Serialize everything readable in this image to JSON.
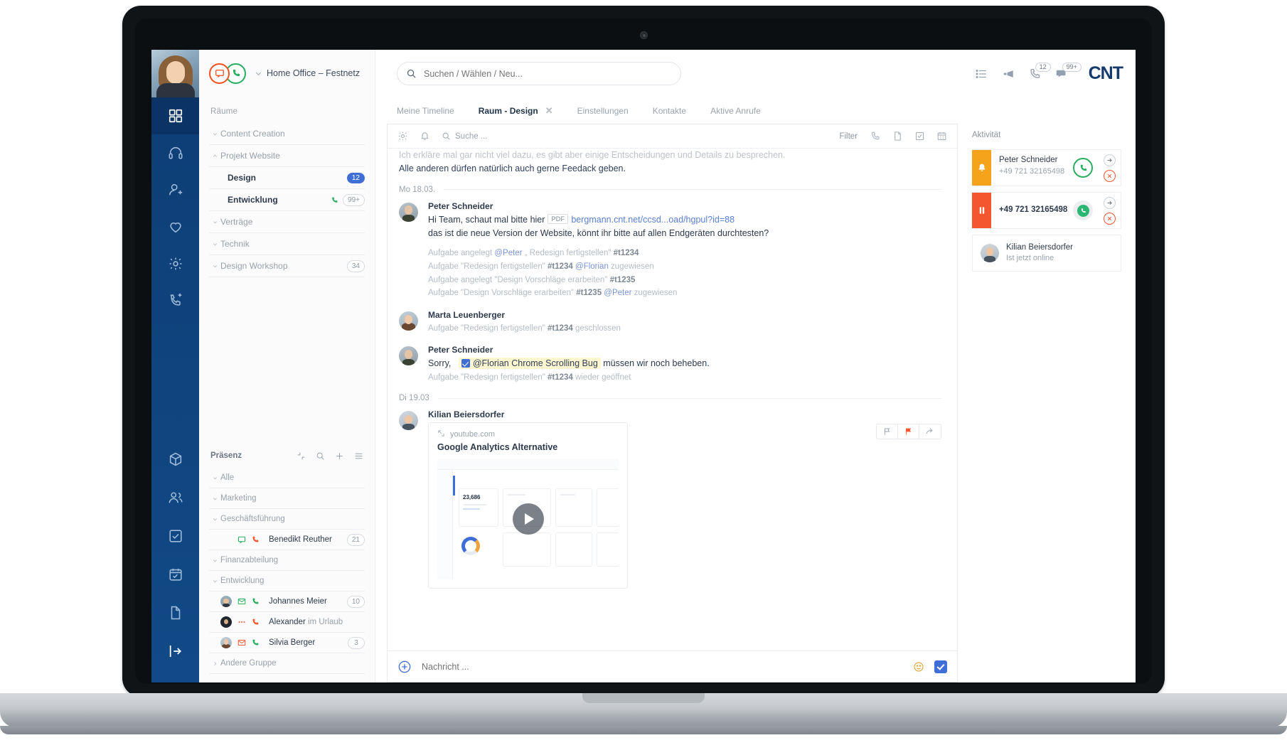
{
  "brand": {
    "logo": "CNT"
  },
  "status": {
    "chat_icon": "chat-bubble-icon",
    "phone_icon": "phone-handset-icon",
    "label": "Home Office – Festnetz"
  },
  "search": {
    "placeholder": "Suchen / Wählen / Neu...",
    "value": ""
  },
  "topbar_icons": [
    {
      "name": "list-icon",
      "badge": ""
    },
    {
      "name": "megaphone-icon",
      "badge": ""
    },
    {
      "name": "phone-icon",
      "badge": "12"
    },
    {
      "name": "chat-icon",
      "badge": "99+"
    }
  ],
  "tabs": [
    {
      "label": "Meine Timeline",
      "active": false,
      "closable": false
    },
    {
      "label": "Raum - Design",
      "active": true,
      "closable": true
    },
    {
      "label": "Einstellungen",
      "active": false,
      "closable": false
    },
    {
      "label": "Kontakte",
      "active": false,
      "closable": false
    },
    {
      "label": "Aktive Anrufe",
      "active": false,
      "closable": false
    }
  ],
  "sidebar": {
    "rooms_title": "Räume",
    "rooms": [
      {
        "label": "Content Creation",
        "type": "group",
        "caret": "down",
        "badge": ""
      },
      {
        "label": "Projekt Website",
        "type": "group",
        "caret": "up",
        "badge": ""
      },
      {
        "label": "Design",
        "type": "leaf",
        "badge": "12",
        "badge_style": "blue"
      },
      {
        "label": "Entwicklung",
        "type": "leaf",
        "badge": "99+",
        "badge_style": "grey",
        "phone": true
      },
      {
        "label": "Verträge",
        "type": "group",
        "caret": "down",
        "badge": ""
      },
      {
        "label": "Technik",
        "type": "group",
        "caret": "down",
        "badge": ""
      },
      {
        "label": "Design Workshop",
        "type": "group",
        "caret": "down",
        "badge": "34",
        "badge_style": "grey"
      }
    ],
    "presence_title": "Präsenz",
    "presence_actions": [
      "collapse-icon",
      "search-icon",
      "plus-icon",
      "menu-icon"
    ],
    "presence": [
      {
        "label": "Alle",
        "type": "group",
        "caret": "down"
      },
      {
        "label": "Marketing",
        "type": "group",
        "caret": "down"
      },
      {
        "label": "Geschäftsführung",
        "type": "group",
        "caret": "down"
      },
      {
        "label": "Benedikt Reuther",
        "type": "member",
        "avatar": false,
        "icon1": "chat-green-icon",
        "icon2": "phone-red-icon",
        "badge": "21",
        "sub": ""
      },
      {
        "label": "Finanzabteilung",
        "type": "group",
        "caret": "down"
      },
      {
        "label": "Entwicklung",
        "type": "group",
        "caret": "down"
      },
      {
        "label": "Johannes Meier",
        "type": "member",
        "avatar": true,
        "avatar_style": "av-p1",
        "icon1": "mail-green-icon",
        "icon2": "phone-green-icon",
        "badge": "10",
        "sub": ""
      },
      {
        "label": "Alexander",
        "type": "member",
        "avatar": true,
        "avatar_style": "av-dark",
        "icon1": "dots-red-icon",
        "icon2": "phone-red-icon",
        "badge": "",
        "sub": "im Urlaub"
      },
      {
        "label": "Silvia Berger",
        "type": "member",
        "avatar": true,
        "avatar_style": "av-p2",
        "icon1": "mail-red-icon",
        "icon2": "phone-green-icon",
        "badge": "3",
        "sub": ""
      },
      {
        "label": "Andere Gruppe",
        "type": "group",
        "caret": "right"
      }
    ]
  },
  "chat": {
    "toolbar": {
      "gear_icon": "gear-icon",
      "bell_icon": "bell-icon",
      "search_placeholder": "Suche ...",
      "filter_label": "Filter",
      "right_icons": [
        "phone-icon",
        "document-icon",
        "task-icon",
        "calendar-icon"
      ]
    },
    "scrolled_lines": [
      "Ich erkläre mal gar nicht viel dazu, es gibt aber einige Entscheidungen und Details zu besprechen.",
      "Alle anderen dürfen natürlich auch gerne Feedack geben."
    ],
    "day1": "Mo 18.03.",
    "day2": "Di 19.03",
    "messages": [
      {
        "author": "Peter Schneider",
        "avatar_style": "av-p3",
        "text_prefix": "Hi Team, schaut mal bitte hier",
        "pdf_chip": "PDF",
        "link": "bergmann.cnt.net/ccsd...oad/hgpul?id=88",
        "text_line2": "das ist die neue Version der Website, könnt ihr bitte auf allen Endgeräten durchtesten?",
        "system_lines": [
          {
            "parts": [
              {
                "t": "Aufgabe angelegt ",
                "k": "plain"
              },
              {
                "t": "@Peter",
                "k": "mention"
              },
              {
                "t": " „ Redesign fertigstellen\" ",
                "k": "plain"
              },
              {
                "t": "#t1234",
                "k": "tid"
              }
            ]
          },
          {
            "parts": [
              {
                "t": "Aufgabe \"Redesign fertigstellen\" ",
                "k": "plain"
              },
              {
                "t": "#t1234",
                "k": "tid"
              },
              {
                "t": " ",
                "k": "plain"
              },
              {
                "t": "@Florian",
                "k": "mention"
              },
              {
                "t": " zugewiesen",
                "k": "plain"
              }
            ]
          },
          {
            "parts": [
              {
                "t": "Aufgabe angelegt \"Design Vorschläge erarbeiten\" ",
                "k": "plain"
              },
              {
                "t": "#t1235",
                "k": "tid"
              }
            ]
          },
          {
            "parts": [
              {
                "t": "Aufgabe \"Design Vorschläge erarbeiten\" ",
                "k": "plain"
              },
              {
                "t": "#t1235",
                "k": "tid"
              },
              {
                "t": " ",
                "k": "plain"
              },
              {
                "t": "@Peter",
                "k": "mention"
              },
              {
                "t": " zugewiesen",
                "k": "plain"
              }
            ]
          }
        ]
      },
      {
        "author": "Marta Leuenberger",
        "avatar_style": "av-p2",
        "system_lines": [
          {
            "parts": [
              {
                "t": "Aufgabe \"Redesign fertigstellen\" ",
                "k": "plain"
              },
              {
                "t": "#t1234",
                "k": "tid"
              },
              {
                "t": " geschlossen",
                "k": "plain"
              }
            ]
          }
        ]
      },
      {
        "author": "Peter Schneider",
        "avatar_style": "av-p3",
        "text_before_chip": "Sorry,",
        "chip_text": "@Florian Chrome Scrolling Bug",
        "text_after_chip": "müssen wir noch beheben.",
        "system_lines": [
          {
            "parts": [
              {
                "t": "Aufgabe \"Redesign fertigstellen\" ",
                "k": "plain"
              },
              {
                "t": "#t1234",
                "k": "tid"
              },
              {
                "t": " wieder geöffnet",
                "k": "plain"
              }
            ]
          }
        ]
      },
      {
        "author": "Kilian Beiersdorfer",
        "avatar_style": "av-p4",
        "preview": {
          "domain": "youtube.com",
          "title": "Google Analytics Alternative",
          "stat": "23,686",
          "play_icon": "play-icon"
        },
        "actions": [
          "flag-outline-icon",
          "flag-red-icon",
          "forward-icon"
        ]
      }
    ],
    "composer": {
      "plus_icon": "plus-circle-icon",
      "placeholder": "Nachricht ...",
      "emoji_icon": "emoji-icon",
      "send_icon": "send-check-icon"
    }
  },
  "activity": {
    "title": "Aktivität",
    "cards": [
      {
        "type": "call",
        "stripe": "amber",
        "stripe_icon": "bell-icon",
        "name": "Peter Schneider",
        "number": "+49 721 32165498",
        "accept_icon": "phone-accept-icon",
        "accept_style": "outline",
        "side_buttons": [
          "arrow-right-icon",
          "decline-x-icon"
        ]
      },
      {
        "type": "call",
        "stripe": "red",
        "stripe_icon": "pause-icon",
        "name": "",
        "number": "+49 721 32165498",
        "accept_icon": "phone-accept-icon",
        "accept_style": "filled",
        "side_buttons": [
          "arrow-right-icon",
          "decline-x-icon"
        ]
      },
      {
        "type": "presence",
        "avatar_style": "av-p4",
        "name": "Kilian Beiersdorfer",
        "status": "Ist jetzt online"
      }
    ]
  },
  "rail": {
    "items": [
      {
        "name": "dashboard-icon",
        "active": true
      },
      {
        "name": "headset-icon",
        "active": false
      },
      {
        "name": "contact-add-icon",
        "active": false
      },
      {
        "name": "heart-icon",
        "active": false
      },
      {
        "name": "gear-icon",
        "active": false
      },
      {
        "name": "phone-settings-icon",
        "active": false
      },
      {
        "name": "box-icon",
        "active": false
      },
      {
        "name": "people-icon",
        "active": false
      },
      {
        "name": "checkbox-icon",
        "active": false
      },
      {
        "name": "tasks-icon",
        "active": false
      },
      {
        "name": "document-icon",
        "active": false
      },
      {
        "name": "logout-icon",
        "active": false
      }
    ]
  },
  "colors": {
    "rail_blue": "#114a87",
    "accent_blue": "#3f6fd6",
    "brand_navy": "#173a6d",
    "green": "#27ae60",
    "red": "#f4562f",
    "amber": "#f5a31a",
    "highlight_yellow": "#fdf6cf"
  }
}
